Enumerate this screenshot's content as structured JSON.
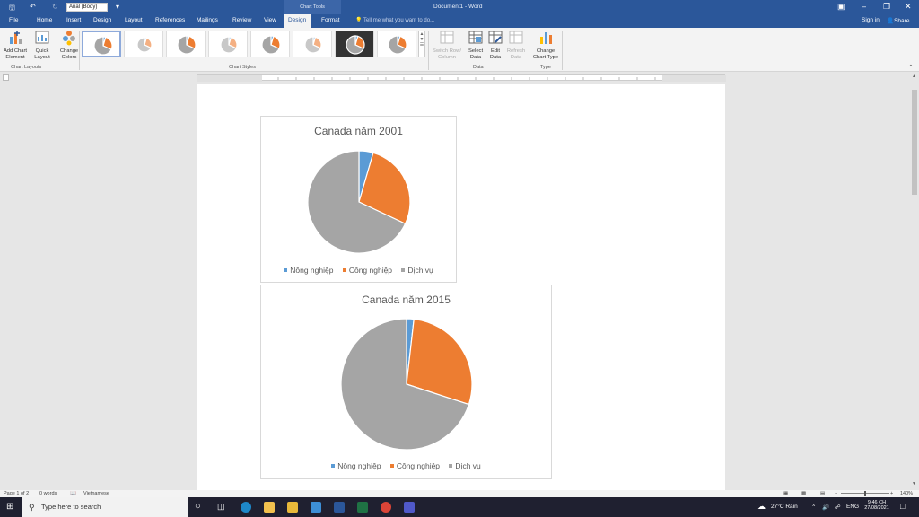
{
  "titlebar": {
    "font_name": "Arial (Body)",
    "doc_title": "Document1 - Word",
    "chart_tools": "Chart Tools"
  },
  "tabs": [
    "File",
    "Home",
    "Insert",
    "Design",
    "Layout",
    "References",
    "Mailings",
    "Review",
    "View",
    "Design",
    "Format"
  ],
  "tell_me": "Tell me what you want to do...",
  "sign_in": "Sign in",
  "share": "Share",
  "ribbon": {
    "add_chart_element": "Add Chart Element",
    "quick_layout": "Quick Layout",
    "change_colors": "Change Colors",
    "switch_row_column": "Switch Row/ Column",
    "select_data": "Select Data",
    "edit_data": "Edit Data",
    "refresh_data": "Refresh Data",
    "change_chart_type": "Change Chart Type",
    "group_chart_layouts": "Chart Layouts",
    "group_chart_styles": "Chart Styles",
    "group_data": "Data",
    "group_type": "Type"
  },
  "colors": {
    "agri": "#5b9bd5",
    "industry": "#ed7d31",
    "service": "#a5a5a5",
    "accent": "#2b579a"
  },
  "chart_data": [
    {
      "type": "pie",
      "title": "Canada năm 2001",
      "categories": [
        "Nông nghiệp",
        "Công nghiệp",
        "Dịch vụ"
      ],
      "values": [
        4.5,
        27.5,
        68
      ],
      "legend": "bottom"
    },
    {
      "type": "pie",
      "title": "Canada năm 2015",
      "categories": [
        "Nông nghiệp",
        "Công nghiệp",
        "Dịch vụ"
      ],
      "values": [
        1.8,
        28.2,
        70
      ],
      "legend": "bottom"
    }
  ],
  "status": {
    "page": "Page 1 of 2",
    "words": "0 words",
    "language": "Vietnamese",
    "zoom": "140%"
  },
  "taskbar": {
    "search_placeholder": "Type here to search",
    "weather": "27°C  Rain",
    "lang": "ENG",
    "time": "9:46 CH",
    "date": "27/08/2021"
  }
}
